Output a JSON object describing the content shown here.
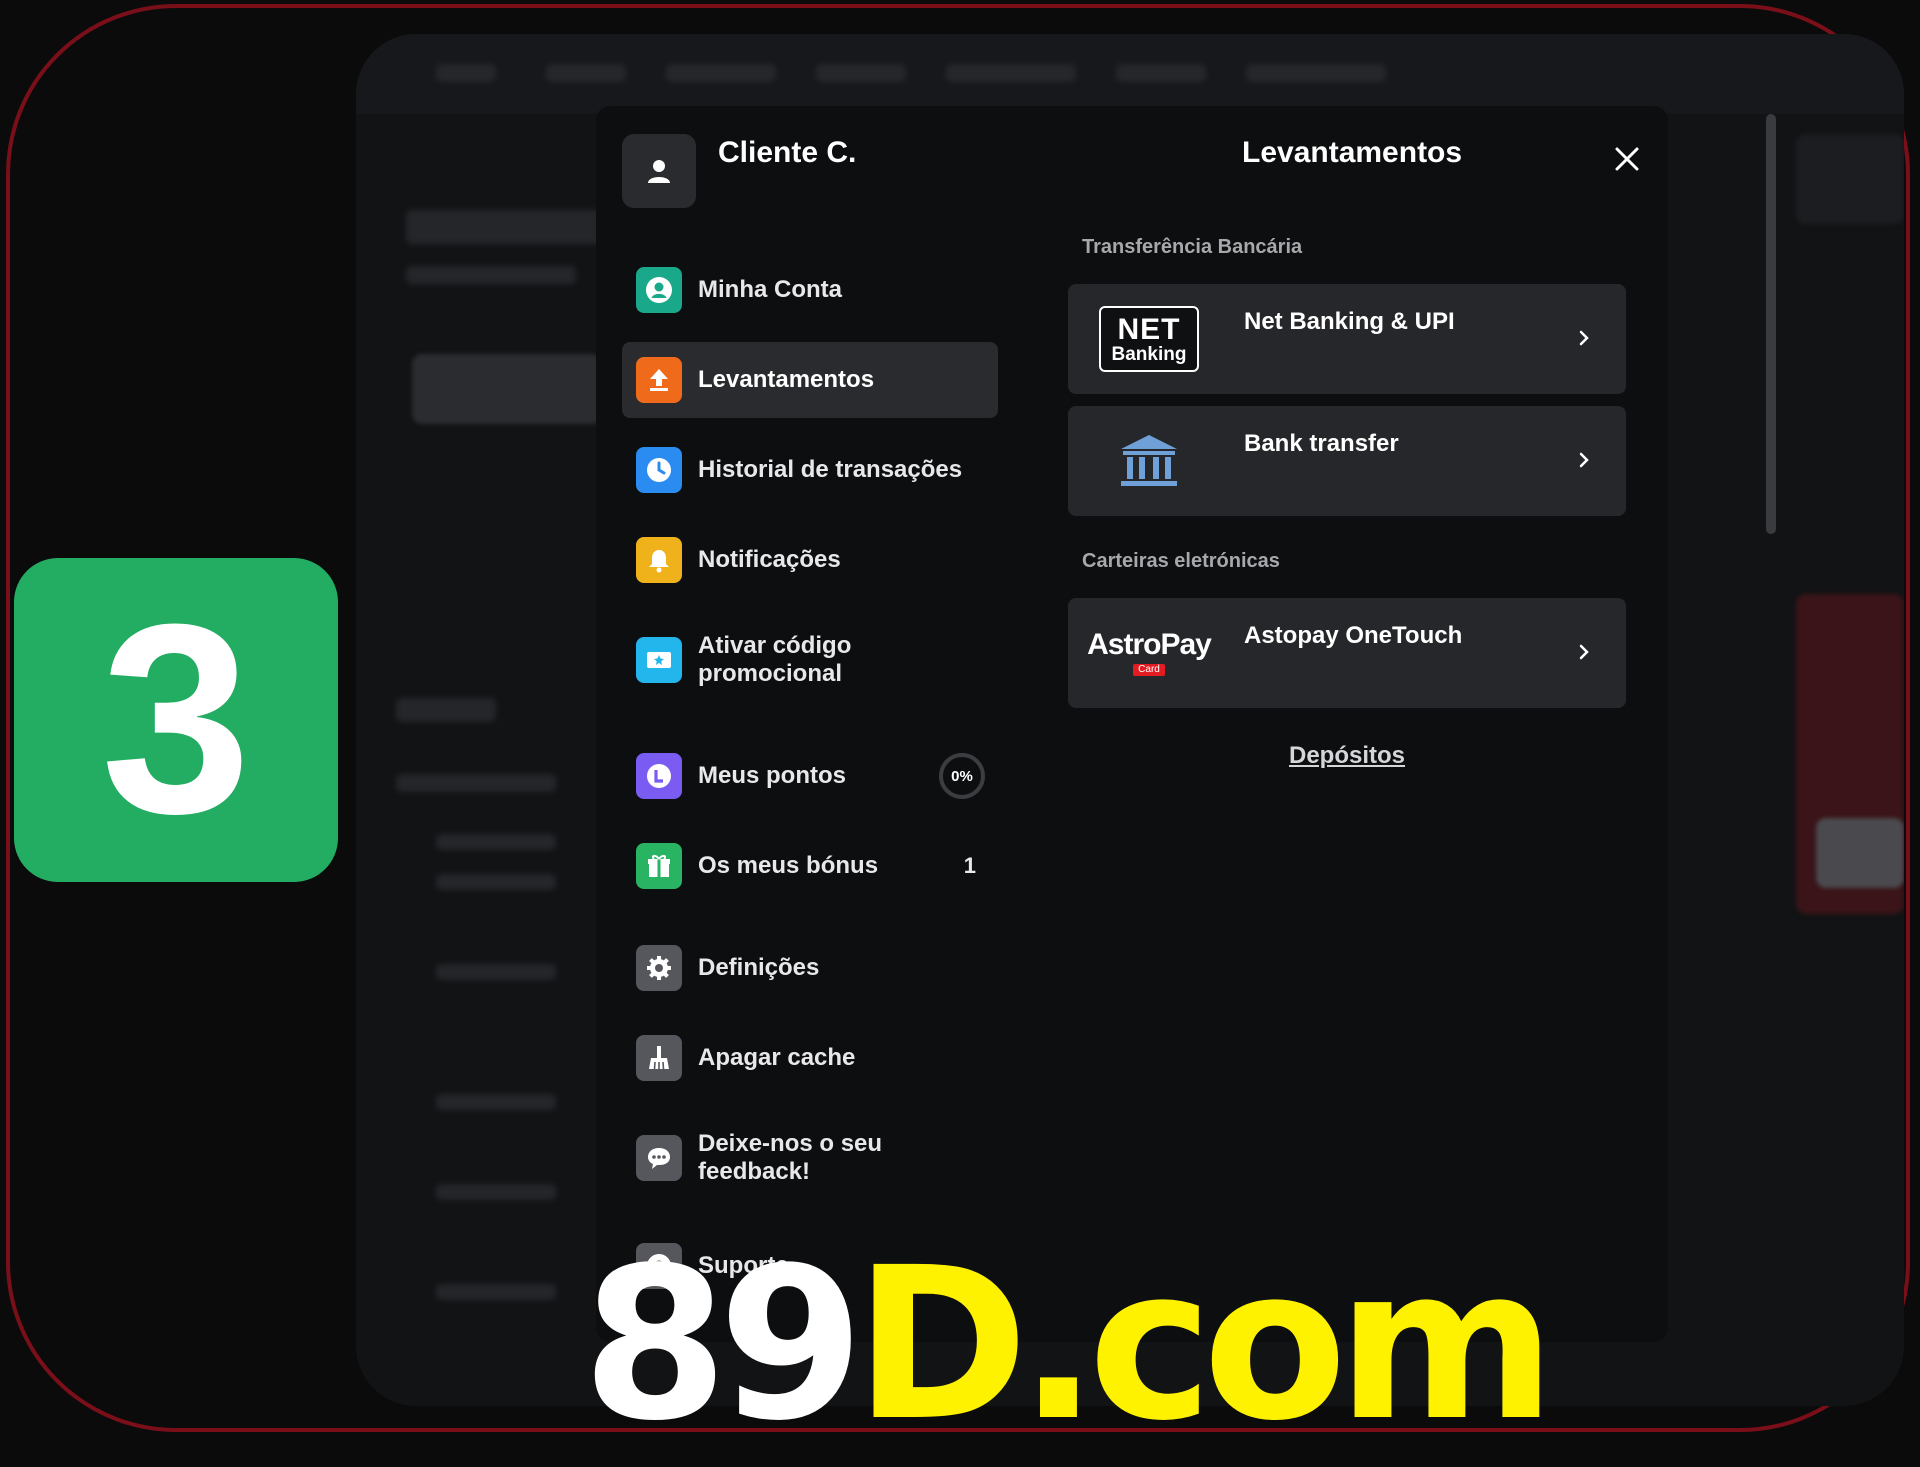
{
  "step_badge": {
    "number": "3",
    "color": "#22ad62"
  },
  "user": {
    "name": "Cliente C."
  },
  "menu": {
    "items": [
      {
        "label": "Minha Conta",
        "icon": "account-icon",
        "color": "#1aa88a"
      },
      {
        "label": "Levantamentos",
        "icon": "withdraw-icon",
        "color": "#ef6a1b",
        "active": true
      },
      {
        "label": "Historial de transações",
        "icon": "clock-icon",
        "color": "#2a8cf0"
      },
      {
        "label": "Notificações",
        "icon": "bell-icon",
        "color": "#f0b21a"
      },
      {
        "label": "Ativar código promocional",
        "icon": "ticket-icon",
        "color": "#22b6ec"
      },
      {
        "label": "Meus pontos",
        "icon": "points-icon",
        "color": "#7b5cf2",
        "progress": "0%"
      },
      {
        "label": "Os meus bónus",
        "icon": "gift-icon",
        "color": "#28b463",
        "count": "1"
      },
      {
        "label": "Definições",
        "icon": "gear-icon",
        "color": "#55575c"
      },
      {
        "label": "Apagar cache",
        "icon": "broom-icon",
        "color": "#55575c"
      },
      {
        "label": "Deixe-nos o seu feedback!",
        "icon": "chat-icon",
        "color": "#55575c"
      },
      {
        "label": "Suporte",
        "icon": "help-icon",
        "color": "#55575c"
      }
    ],
    "partial_item_text": "S"
  },
  "panel": {
    "title": "Levantamentos",
    "sections": [
      {
        "label": "Transferência Bancária"
      },
      {
        "label": "Carteiras eletrónicas"
      }
    ],
    "methods": [
      {
        "name": "Net Banking & UPI",
        "logo_line1": "NET",
        "logo_line2": "Banking"
      },
      {
        "name": "Bank transfer",
        "logo": "bank-icon"
      },
      {
        "name": "Astopay OneTouch",
        "logo_line1": "AstroPay",
        "logo_line2": "Card"
      }
    ],
    "deposits_link": "Depósitos"
  },
  "watermark": {
    "part1": "89",
    "part2": "D.com"
  }
}
